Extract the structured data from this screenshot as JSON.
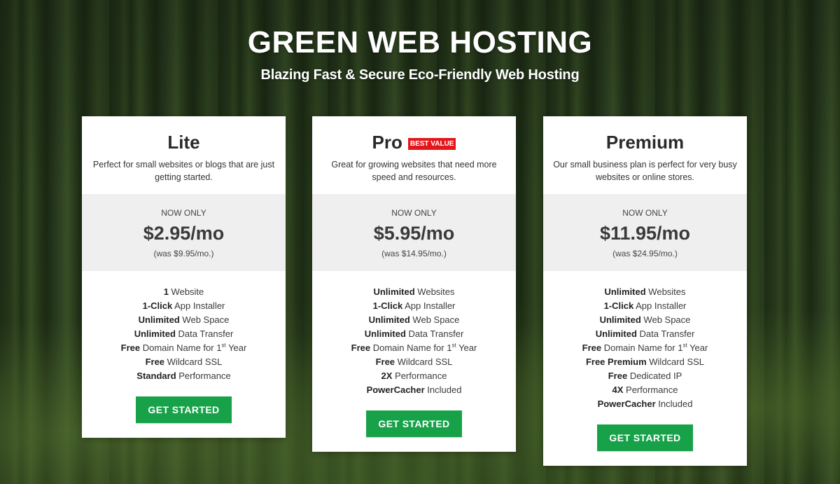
{
  "hero": {
    "title": "GREEN WEB HOSTING",
    "subtitle": "Blazing Fast & Secure Eco-Friendly Web Hosting"
  },
  "colors": {
    "cta_button": "#17a24a",
    "badge": "#e3171b",
    "price_band": "#efefef"
  },
  "plans": [
    {
      "name": "Lite",
      "badge": "",
      "description": "Perfect for small websites or blogs that are just getting started.",
      "now_only": "NOW ONLY",
      "price": "$2.95/mo",
      "was": "(was $9.95/mo.)",
      "features": [
        {
          "bold": "1",
          "text": " Website"
        },
        {
          "bold": "1-Click",
          "text": " App Installer"
        },
        {
          "bold": "Unlimited",
          "text": " Web Space"
        },
        {
          "bold": "Unlimited",
          "text": " Data Transfer"
        },
        {
          "bold": "Free",
          "text": " Domain Name for 1",
          "sup": "st",
          "after": " Year"
        },
        {
          "bold": "Free",
          "text": " Wildcard SSL"
        },
        {
          "bold": "Standard",
          "text": " Performance"
        }
      ],
      "cta": "GET STARTED"
    },
    {
      "name": "Pro",
      "badge": "BEST VALUE",
      "description": "Great for growing websites that need more speed and resources.",
      "now_only": "NOW ONLY",
      "price": "$5.95/mo",
      "was": "(was $14.95/mo.)",
      "features": [
        {
          "bold": "Unlimited",
          "text": " Websites"
        },
        {
          "bold": "1-Click",
          "text": " App Installer"
        },
        {
          "bold": "Unlimited",
          "text": " Web Space"
        },
        {
          "bold": "Unlimited",
          "text": " Data Transfer"
        },
        {
          "bold": "Free",
          "text": " Domain Name for 1",
          "sup": "st",
          "after": " Year"
        },
        {
          "bold": "Free",
          "text": " Wildcard SSL"
        },
        {
          "bold": "2X",
          "text": " Performance"
        },
        {
          "bold": "PowerCacher",
          "text": " Included"
        }
      ],
      "cta": "GET STARTED"
    },
    {
      "name": "Premium",
      "badge": "",
      "description": "Our small business plan is perfect for very busy websites or online stores.",
      "now_only": "NOW ONLY",
      "price": "$11.95/mo",
      "was": "(was $24.95/mo.)",
      "features": [
        {
          "bold": "Unlimited",
          "text": " Websites"
        },
        {
          "bold": "1-Click",
          "text": " App Installer"
        },
        {
          "bold": "Unlimited",
          "text": " Web Space"
        },
        {
          "bold": "Unlimited",
          "text": " Data Transfer"
        },
        {
          "bold": "Free",
          "text": " Domain Name for 1",
          "sup": "st",
          "after": " Year"
        },
        {
          "bold": "Free Premium",
          "text": " Wildcard SSL"
        },
        {
          "bold": "Free",
          "text": " Dedicated IP"
        },
        {
          "bold": "4X",
          "text": " Performance"
        },
        {
          "bold": "PowerCacher",
          "text": " Included"
        }
      ],
      "cta": "GET STARTED"
    }
  ]
}
